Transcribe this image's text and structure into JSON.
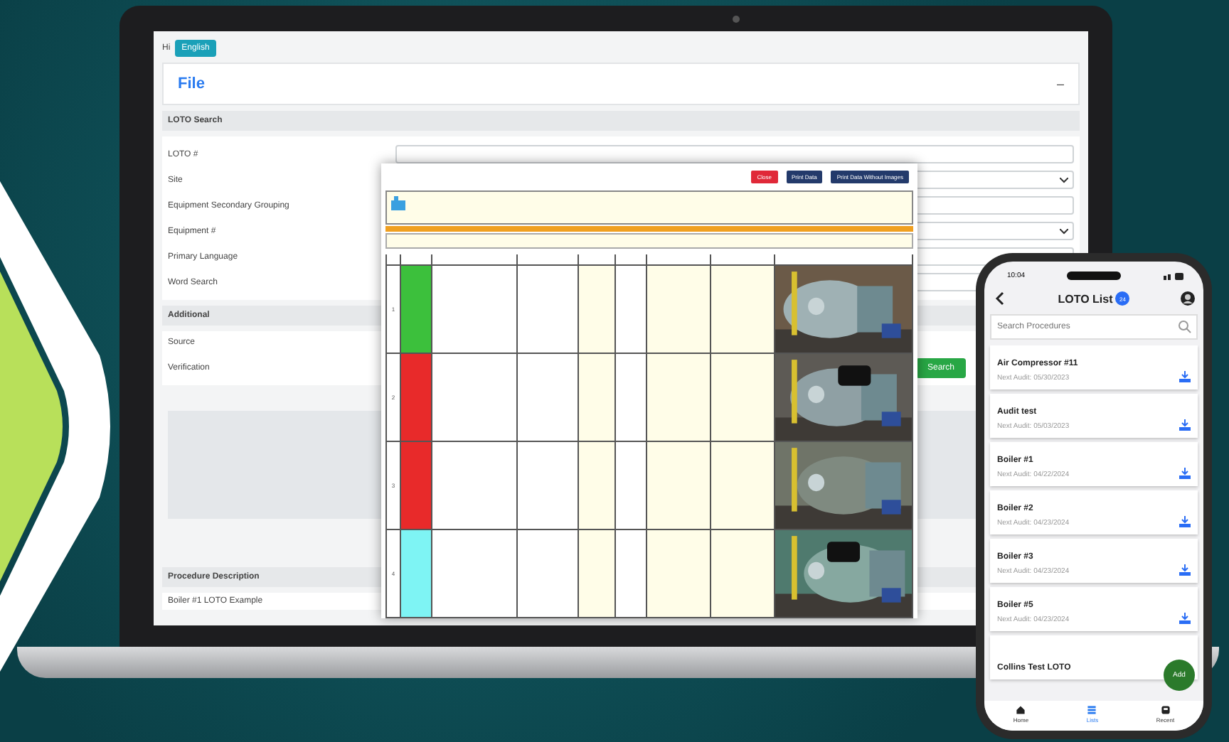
{
  "laptop": {
    "greeting": "Hi",
    "language_button": "English",
    "panel_title": "File",
    "collapse": "–",
    "search_section": "LOTO Search",
    "fields": [
      {
        "label": "LOTO #",
        "kind": "input"
      },
      {
        "label": "Site",
        "kind": "select"
      },
      {
        "label": "Equipment Secondary Grouping",
        "kind": "input"
      },
      {
        "label": "Equipment #",
        "kind": "select"
      },
      {
        "label": "Primary Language",
        "kind": "input"
      },
      {
        "label": "Word Search",
        "kind": "input"
      }
    ],
    "additional_section": "Additional",
    "filters": [
      {
        "label": "Source"
      },
      {
        "label": "Verification"
      }
    ],
    "search_button": "Search",
    "description_header": "Procedure Description",
    "description": "Boiler #1 LOTO Example"
  },
  "document": {
    "buttons": [
      {
        "label": "Close",
        "kind": "danger"
      },
      {
        "label": "Print Data",
        "kind": "primary"
      },
      {
        "label": "Print Data Without Images",
        "kind": "primary"
      }
    ],
    "rows": [
      {
        "number": "1",
        "color": "#3cc03c",
        "kind": "picture"
      },
      {
        "number": "2",
        "color": "#e82a2a",
        "kind": "picture"
      },
      {
        "number": "3",
        "color": "#e82a2a",
        "kind": "picture"
      },
      {
        "number": "4",
        "color": "#7ef4f4",
        "kind": "picture"
      }
    ]
  },
  "phone": {
    "time": "10:04",
    "title": "LOTO List",
    "badge": "24",
    "search_placeholder": "Search Procedures",
    "items": [
      {
        "name": "Air Compressor #11",
        "audit": "Next Audit: 05/30/2023"
      },
      {
        "name": "Audit test",
        "audit": "Next Audit: 05/03/2023"
      },
      {
        "name": "Boiler #1",
        "audit": "Next Audit: 04/22/2024"
      },
      {
        "name": "Boiler #2",
        "audit": "Next Audit: 04/23/2024"
      },
      {
        "name": "Boiler #3",
        "audit": "Next Audit: 04/23/2024"
      },
      {
        "name": "Boiler #5",
        "audit": "Next Audit: 04/23/2024"
      },
      {
        "name": "Collins Test LOTO"
      }
    ],
    "fab": "Add",
    "tabs": [
      {
        "label": "Home",
        "selected": false
      },
      {
        "label": "Lists",
        "selected": true
      },
      {
        "label": "Recent",
        "selected": false
      }
    ]
  }
}
